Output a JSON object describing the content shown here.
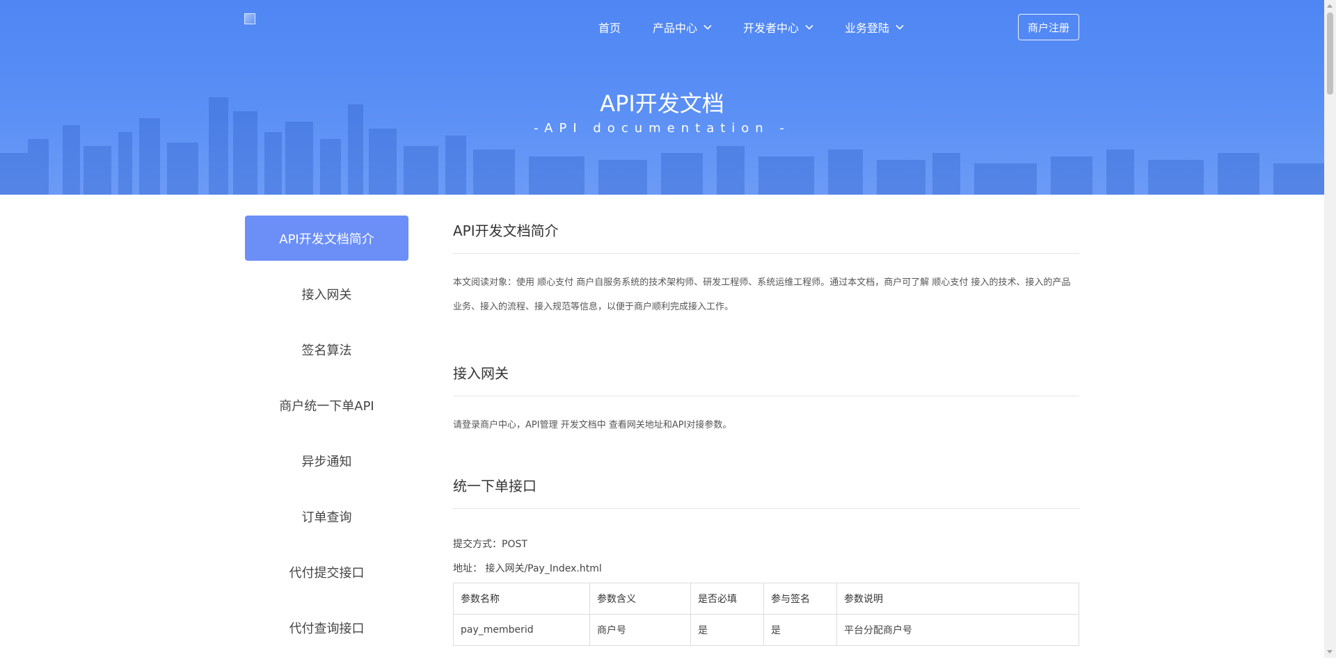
{
  "nav": {
    "home": "首页",
    "products": "产品中心",
    "developer": "开发者中心",
    "login": "业务登陆",
    "register": "商户注册"
  },
  "hero": {
    "title": "API开发文档",
    "subtitle": "-API documentation -"
  },
  "sidebar": {
    "items": [
      {
        "label": "API开发文档简介"
      },
      {
        "label": "接入网关"
      },
      {
        "label": "签名算法"
      },
      {
        "label": "商户统一下单API"
      },
      {
        "label": "异步通知"
      },
      {
        "label": "订单查询"
      },
      {
        "label": "代付提交接口"
      },
      {
        "label": "代付查询接口"
      }
    ]
  },
  "sections": {
    "intro": {
      "title": "API开发文档简介",
      "text": "本文阅读对象：使用 顺心支付 商户自服务系统的技术架构师、研发工程师、系统运维工程师。通过本文档，商户可了解 顺心支付 接入的技术、接入的产品业务、接入的流程、接入规范等信息，以便于商户顺利完成接入工作。"
    },
    "gateway": {
      "title": "接入网关",
      "text": "请登录商户中心，API管理 开发文档中 查看网关地址和API对接参数。"
    },
    "order": {
      "title": "统一下单接口",
      "method": "提交方式：POST",
      "address": "地址：   接入网关/Pay_Index.html",
      "table": {
        "headers": [
          "参数名称",
          "参数含义",
          "是否必填",
          "参与签名",
          "参数说明"
        ],
        "rows": [
          [
            "pay_memberid",
            "商户号",
            "是",
            "是",
            "平台分配商户号"
          ]
        ]
      }
    }
  }
}
